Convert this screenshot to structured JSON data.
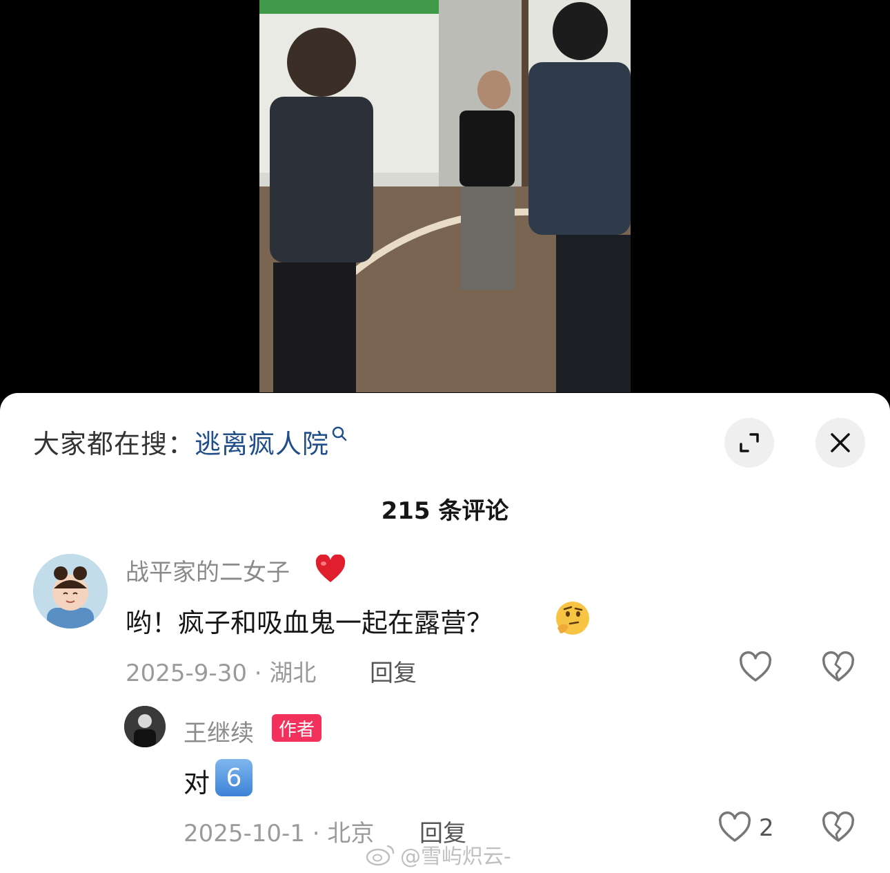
{
  "video": {},
  "search": {
    "prefix": "大家都在搜：",
    "term": "逃离疯人院"
  },
  "comments_header": {
    "count_label": "215 条评论"
  },
  "comments": [
    {
      "username": "战平家的二女子",
      "text": "哟！疯子和吸血鬼一起在露营？",
      "meta": "2025-9-30 · 湖北",
      "reply_label": "回复"
    },
    {
      "username": "王继续",
      "badge": "作者",
      "text": "对",
      "emoji": "6",
      "meta": "2025-10-1 · 北京",
      "reply_label": "回复",
      "like_count": "2"
    }
  ],
  "watermark": {
    "text": "@雪屿炽云-"
  },
  "colors": {
    "search_term": "#1f4e8a",
    "author_badge": "#f2325c"
  }
}
